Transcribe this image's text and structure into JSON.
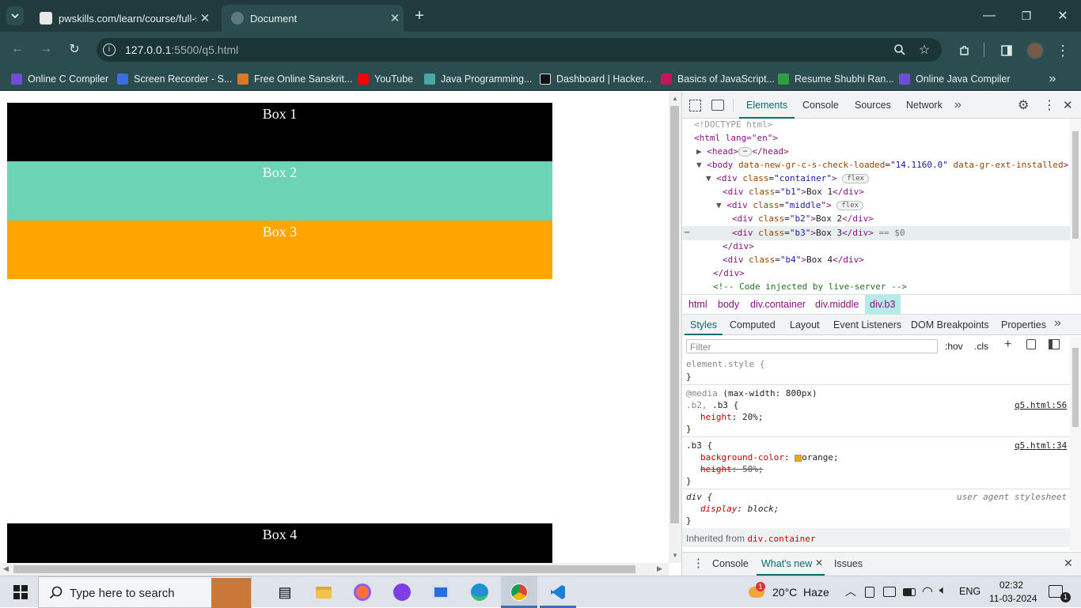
{
  "browser": {
    "tabs": [
      {
        "title": "pwskills.com/learn/course/full-s",
        "active": false
      },
      {
        "title": "Document",
        "active": true
      }
    ],
    "address": {
      "host": "127.0.0.1",
      "rest": ":5500/q5.html"
    },
    "bookmarks": [
      {
        "label": "Online C Compiler",
        "color": "#6c4fd6"
      },
      {
        "label": "Screen Recorder - S...",
        "color": "#3b6ee0"
      },
      {
        "label": "Free Online Sanskrit...",
        "color": "#d67a2a"
      },
      {
        "label": "YouTube",
        "color": "#ff0000"
      },
      {
        "label": "Java Programming...",
        "color": "#4aa7a2"
      },
      {
        "label": "Dashboard | Hacker...",
        "color": "#111111"
      },
      {
        "label": "Basics of JavaScript...",
        "color": "#c2185b"
      },
      {
        "label": "Resume Shubhi Ran...",
        "color": "#2e9e3e"
      },
      {
        "label": "Online Java Compiler",
        "color": "#6c4fd6"
      }
    ]
  },
  "page": {
    "boxes": [
      {
        "label": "Box 1",
        "color": "#000000",
        "text_color": "#ffffff"
      },
      {
        "label": "Box 2",
        "color": "#6ad4b4",
        "text_color": "#ffffff"
      },
      {
        "label": "Box 3",
        "color": "#ffa500",
        "text_color": "#ffffff"
      },
      {
        "label": "Box 4",
        "color": "#000000",
        "text_color": "#ffffff"
      }
    ]
  },
  "devtools": {
    "tabs": [
      "Elements",
      "Console",
      "Sources",
      "Network"
    ],
    "dom": {
      "doctype": "<!DOCTYPE html>",
      "html_open": "<html lang=\"en\">",
      "head_open": "<head>",
      "head_close": "</head>",
      "body_tag": "<body",
      "body_attr1": "data-new-gr-c-s-check-loaded",
      "body_val1": "\"14.1160.0\"",
      "body_attr2": "data-gr-ext-installed",
      "body_close": ">",
      "div_open": "<div",
      "class_attr": "class",
      "container_val": "\"container\"",
      "b1_val": "\"b1\"",
      "middle_val": "\"middle\"",
      "b2_val": "\"b2\"",
      "b3_val": "\"b3\"",
      "b4_val": "\"b4\"",
      "gt": ">",
      "div_close": "</div>",
      "box1": "Box 1",
      "box2": "Box 2",
      "box3": "Box 3",
      "box4": "Box 4",
      "selected_marker": "== $0",
      "flex_badge": "flex",
      "comment": "<!-- Code injected by live-server -->"
    },
    "breadcrumbs": [
      "html",
      "body",
      "div.container",
      "div.middle",
      "div.b3"
    ],
    "style_tabs": [
      "Styles",
      "Computed",
      "Layout",
      "Event Listeners",
      "DOM Breakpoints",
      "Properties"
    ],
    "filter_placeholder": "Filter",
    "hov": ":hov",
    "cls": ".cls",
    "rules": {
      "element_style": "element.style {",
      "close_brace": "}",
      "media": "@media",
      "media_query": "(max-width: 800px)",
      "media_selector_dim": ".b2,",
      "media_selector": ".b3 {",
      "media_src": "q5.html:56",
      "media_prop": "height",
      "media_val": "20%;",
      "b3_selector": ".b3 {",
      "b3_src": "q5.html:34",
      "bg_prop": "background-color",
      "bg_val": "orange;",
      "height_prop": "height",
      "height_val": "50%;",
      "div_selector": "div {",
      "ua_label": "user agent stylesheet",
      "display_prop": "display",
      "display_val": "block;",
      "inherited_label": "Inherited from",
      "inherited_from": "div.container"
    },
    "drawer_tabs": [
      "Console",
      "What's new",
      "Issues"
    ]
  },
  "taskbar": {
    "search_placeholder": "Type here to search",
    "weather": "20°C  Haze",
    "weather_badge": "1",
    "lang": "ENG",
    "time": "02:32",
    "date": "11-03-2024",
    "notification_count": "1"
  }
}
